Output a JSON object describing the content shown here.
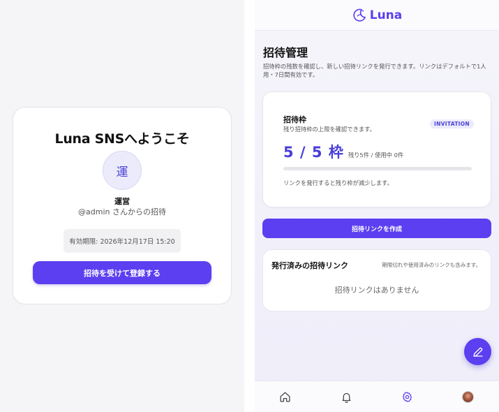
{
  "invite": {
    "title": "Luna SNSへようこそ",
    "avatar_initial": "運",
    "inviter_name": "運営",
    "inviter_handle": "@admin さんからの招待",
    "expiry": "有効期限: 2026年12月17日 15:20",
    "accept_label": "招待を受けて登録する"
  },
  "header": {
    "logo_text": "Luna",
    "logo_icon": "moon-icon"
  },
  "page": {
    "title": "招待管理",
    "description": "招待枠の残数を確認し、新しい招待リンクを発行できます。リンクはデフォルトで1人用・7日間有効です。"
  },
  "quota": {
    "title": "招待枠",
    "subtitle": "残り招待枠の上限を確認できます。",
    "badge": "INVITATION",
    "value": "5 / 5 枠",
    "detail": "残り5件 / 使用中 0件",
    "used_fraction": 0,
    "note": "リンクを発行すると残り枠が減少します。"
  },
  "create_label": "招待リンクを作成",
  "links": {
    "title": "発行済みの招待リンク",
    "note": "期限切れや使用済みのリンクも含みます。",
    "empty": "招待リンクはありません"
  },
  "nav": {
    "items": [
      "home-icon",
      "bell-icon",
      "gear-icon",
      "avatar"
    ],
    "active": "gear-icon"
  },
  "colors": {
    "accent": "#5b3ff0",
    "inactive_icon": "#444444"
  }
}
